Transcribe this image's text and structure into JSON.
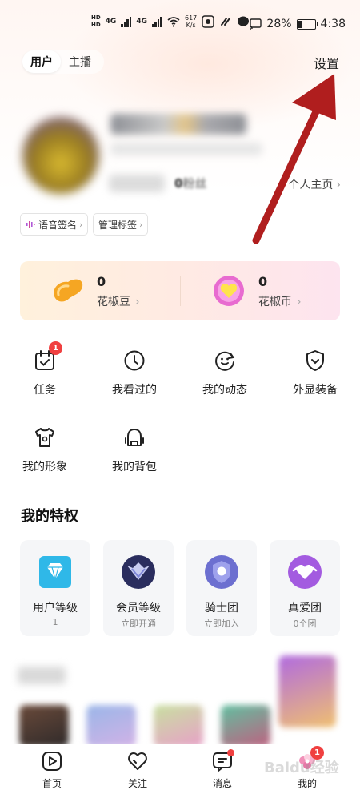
{
  "status_bar": {
    "hd": "HD",
    "net1": "4G",
    "net2": "4G",
    "speed_value": "617",
    "speed_unit": "K/s",
    "battery_percent": "28%",
    "battery_level": 0.28,
    "time": "4:38"
  },
  "top_tabs": [
    {
      "label": "用户",
      "active": true
    },
    {
      "label": "主播",
      "active": false
    }
  ],
  "header": {
    "settings_label": "设置"
  },
  "profile": {
    "fans_count": "0",
    "fans_label": "粉丝",
    "homepage_label": "个人主页",
    "chevron": "›"
  },
  "tags": [
    {
      "label": "语音签名",
      "icon": "voice-wave-icon"
    },
    {
      "label": "管理标签"
    }
  ],
  "wallet": {
    "pepper_beans": {
      "value": "0",
      "label": "花椒豆",
      "icon": "bean-icon"
    },
    "pepper_coins": {
      "value": "0",
      "label": "花椒币",
      "icon": "coin-heart-icon"
    }
  },
  "features": [
    {
      "label": "任务",
      "icon": "task-calendar-icon",
      "badge": "1"
    },
    {
      "label": "我看过的",
      "icon": "clock-icon"
    },
    {
      "label": "我的动态",
      "icon": "smile-refresh-icon"
    },
    {
      "label": "外显装备",
      "icon": "shield-icon"
    },
    {
      "label": "我的形象",
      "icon": "shirt-icon"
    },
    {
      "label": "我的背包",
      "icon": "backpack-icon"
    }
  ],
  "privileges_title": "我的特权",
  "privileges": [
    {
      "name": "用户等级",
      "sub": "1",
      "icon": "diamond-icon",
      "color": "#2fb8e8"
    },
    {
      "name": "会员等级",
      "sub": "立即开通",
      "icon": "vip-crest-icon",
      "color": "#3b3f7a"
    },
    {
      "name": "骑士团",
      "sub": "立即加入",
      "icon": "knight-badge-icon",
      "color": "#6c6fd0"
    },
    {
      "name": "真爱团",
      "sub": "0个团",
      "icon": "love-group-icon",
      "color": "#a35be0"
    }
  ],
  "bottom_nav": [
    {
      "label": "首页",
      "icon": "play-home-icon"
    },
    {
      "label": "关注",
      "icon": "heart-icon"
    },
    {
      "label": "消息",
      "icon": "message-icon",
      "dot": true
    },
    {
      "label": "我的",
      "icon": "me-flower-icon",
      "badge": "1"
    }
  ],
  "watermark": "Baidu经验",
  "colors": {
    "badge_red": "#f04040",
    "annotation_arrow": "#b01e1e"
  }
}
